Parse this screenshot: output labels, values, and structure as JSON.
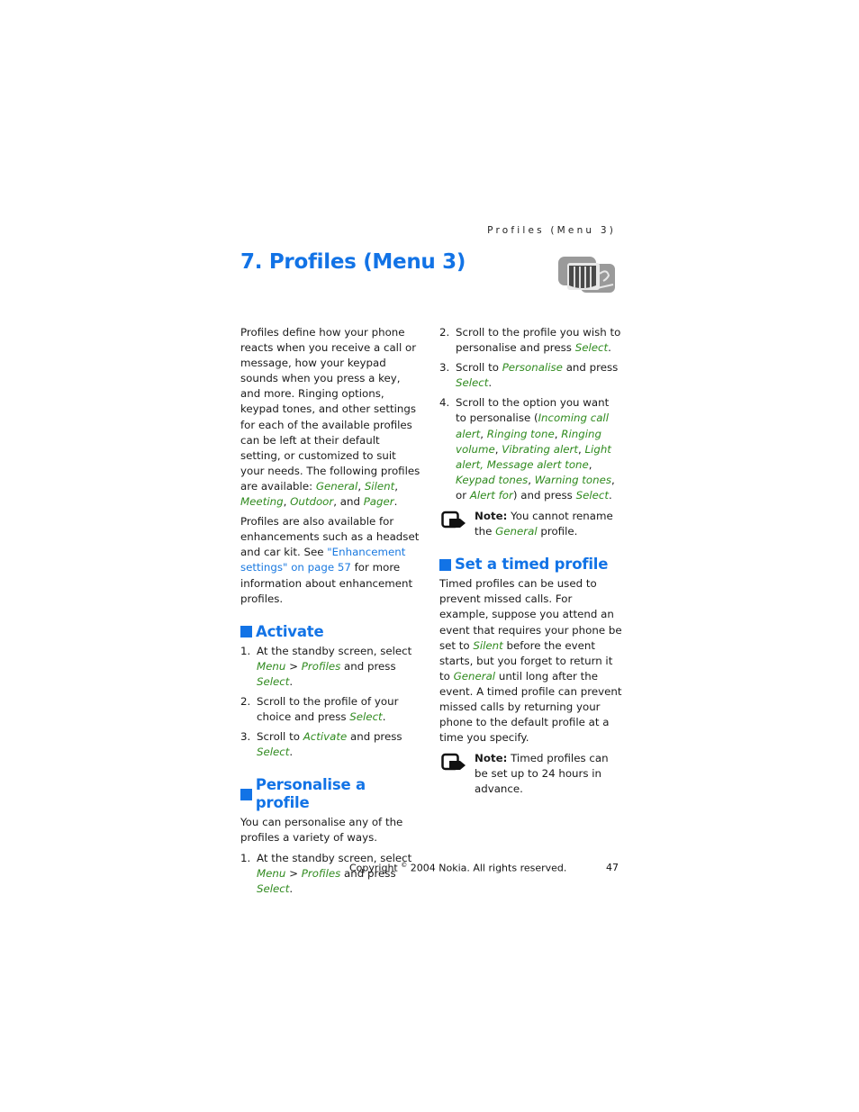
{
  "running_head": "Profiles (Menu 3)",
  "chapter": {
    "title": "7. Profiles (Menu 3)",
    "icon": "profiles-drum-icon"
  },
  "colors": {
    "heading_blue": "#1273e6",
    "menu_green": "#2f8a1e",
    "link_blue": "#1a79e0"
  },
  "intro": {
    "p1_text": "Profiles define how your phone reacts when you receive a call or message, how your keypad sounds when you press a key, and more. Ringing options, keypad tones, and other settings for each of the available profiles can be left at their default setting, or customized to suit your needs. The following profiles are available: ",
    "profiles": [
      "General",
      "Silent",
      "Meeting",
      "Outdoor",
      "Pager"
    ],
    "sep_comma": ", ",
    "sep_and": ", and ",
    "end": ".",
    "p2_before": "Profiles are also available for enhancements such as a headset and car kit. See ",
    "p2_link": "\"Enhancement settings\" on page 57",
    "p2_after": " for more information about enhancement profiles."
  },
  "activate": {
    "heading": "Activate",
    "steps": [
      {
        "num": "1.",
        "t1": "At the standby screen, select ",
        "m1": "Menu",
        "t2": " > ",
        "m2": "Profiles",
        "t3": " and press ",
        "m3": "Select",
        "t4": "."
      },
      {
        "num": "2.",
        "t1": "Scroll to the profile of your choice and press ",
        "m1": "Select",
        "t2": "."
      },
      {
        "num": "3.",
        "t1": "Scroll to ",
        "m1": "Activate",
        "t2": " and press ",
        "m2": "Select",
        "t3": "."
      }
    ]
  },
  "personalise": {
    "heading": "Personalise a profile",
    "intro": "You can personalise any of the profiles a variety of ways.",
    "steps": [
      {
        "num": "1.",
        "t1": "At the standby screen, select ",
        "m1": "Menu",
        "t2": " > ",
        "m2": "Profiles",
        "t3": " and press ",
        "m3": "Select",
        "t4": "."
      },
      {
        "num": "2.",
        "t1": "Scroll to the profile you wish to personalise and press ",
        "m1": "Select",
        "t2": "."
      },
      {
        "num": "3.",
        "t1": "Scroll to ",
        "m1": "Personalise",
        "t2": " and press ",
        "m2": "Select",
        "t3": "."
      },
      {
        "num": "4.",
        "t1": "Scroll to the option you want to personalise (",
        "options": [
          "Incoming call alert",
          "Ringing tone",
          "Ringing volume",
          "Vibrating alert",
          "Light alert",
          "Message alert tone",
          "Keypad tones",
          "Warning tones",
          "Alert for"
        ],
        "or": ", or ",
        "t2": ") and press ",
        "m_last": "Select",
        "t3": "."
      }
    ],
    "note": {
      "label": "Note:",
      "t1": " You cannot rename the ",
      "m1": "General",
      "t2": " profile."
    }
  },
  "timed": {
    "heading": "Set a timed profile",
    "t1": "Timed profiles can be used to prevent missed calls. For example, suppose you attend an event that requires your phone be set to ",
    "m1": "Silent",
    "t2": " before the event starts, but you forget to return it to ",
    "m2": "General",
    "t3": " until long after the event. A timed profile can prevent missed calls by returning your phone to the default profile at a time you specify.",
    "note": {
      "label": "Note:",
      "text": " Timed profiles can be set up to 24 hours in advance."
    }
  },
  "footer": {
    "copyright_pre": "Copyright ",
    "copyright_symbol": "©",
    "copyright_post": " 2004 Nokia. All rights reserved.",
    "page_number": "47"
  }
}
